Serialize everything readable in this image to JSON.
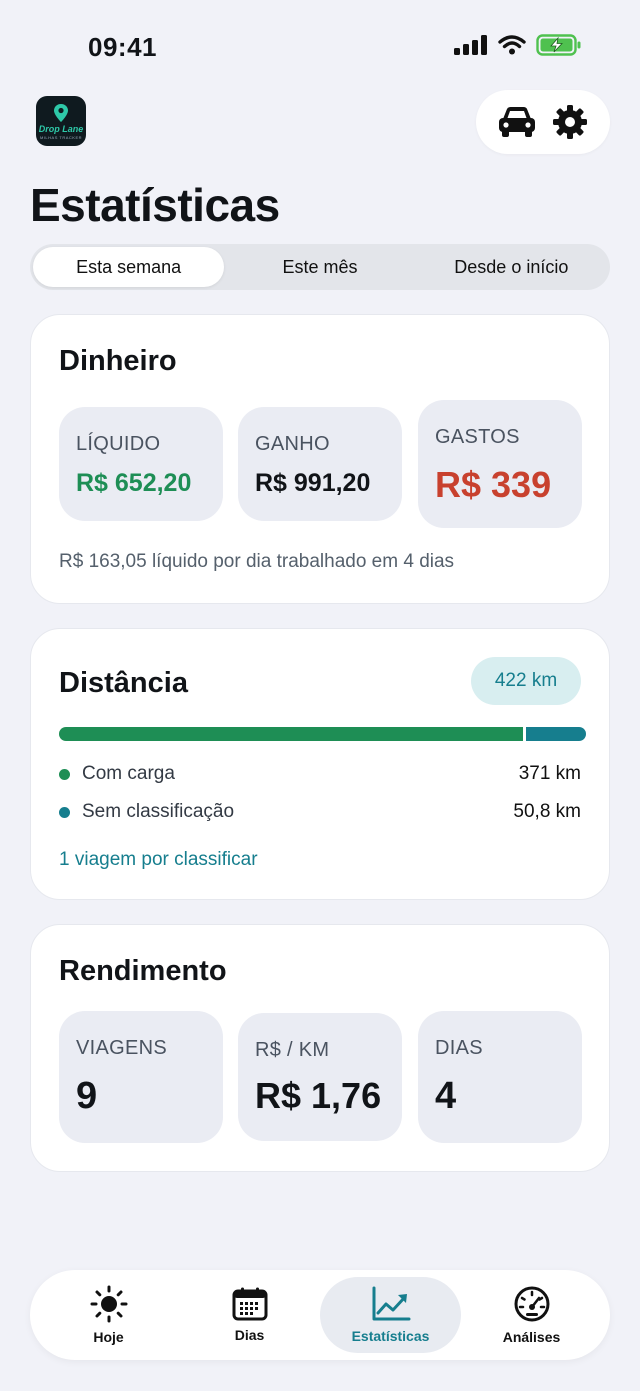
{
  "status": {
    "time": "09:41"
  },
  "app": {
    "logo_text": "Drop Lane",
    "logo_sub": "MILHAS TRACKER"
  },
  "title": "Estatísticas",
  "tabs": [
    {
      "label": "Esta semana",
      "active": true
    },
    {
      "label": "Este mês",
      "active": false
    },
    {
      "label": "Desde o início",
      "active": false
    }
  ],
  "money": {
    "title": "Dinheiro",
    "tiles": [
      {
        "label": "LÍQUIDO",
        "value": "R$ 652,20"
      },
      {
        "label": "GANHO",
        "value": "R$ 991,20"
      },
      {
        "label": "GASTOS",
        "value": "R$ 339"
      }
    ],
    "summary": "R$ 163,05 líquido por dia trabalhado em 4 dias"
  },
  "distance": {
    "title": "Distância",
    "total": "422 km",
    "loaded_fraction": 0.88,
    "legend": [
      {
        "label": "Com carga",
        "value": "371 km"
      },
      {
        "label": "Sem classificação",
        "value": "50,8 km"
      }
    ],
    "pending": "1 viagem por classificar"
  },
  "yield": {
    "title": "Rendimento",
    "tiles": [
      {
        "label": "VIAGENS",
        "value": "9"
      },
      {
        "label": "R$ / KM",
        "value": "R$ 1,76"
      },
      {
        "label": "DIAS",
        "value": "4"
      }
    ]
  },
  "nav": [
    {
      "label": "Hoje",
      "icon": "sun-icon"
    },
    {
      "label": "Dias",
      "icon": "calendar-icon"
    },
    {
      "label": "Estatísticas",
      "icon": "chart-icon",
      "active": true
    },
    {
      "label": "Análises",
      "icon": "gauge-icon"
    }
  ],
  "colors": {
    "accent": "#167e8e",
    "positive": "#1e8e55",
    "negative": "#c8412e",
    "background": "#f1f2f8"
  }
}
